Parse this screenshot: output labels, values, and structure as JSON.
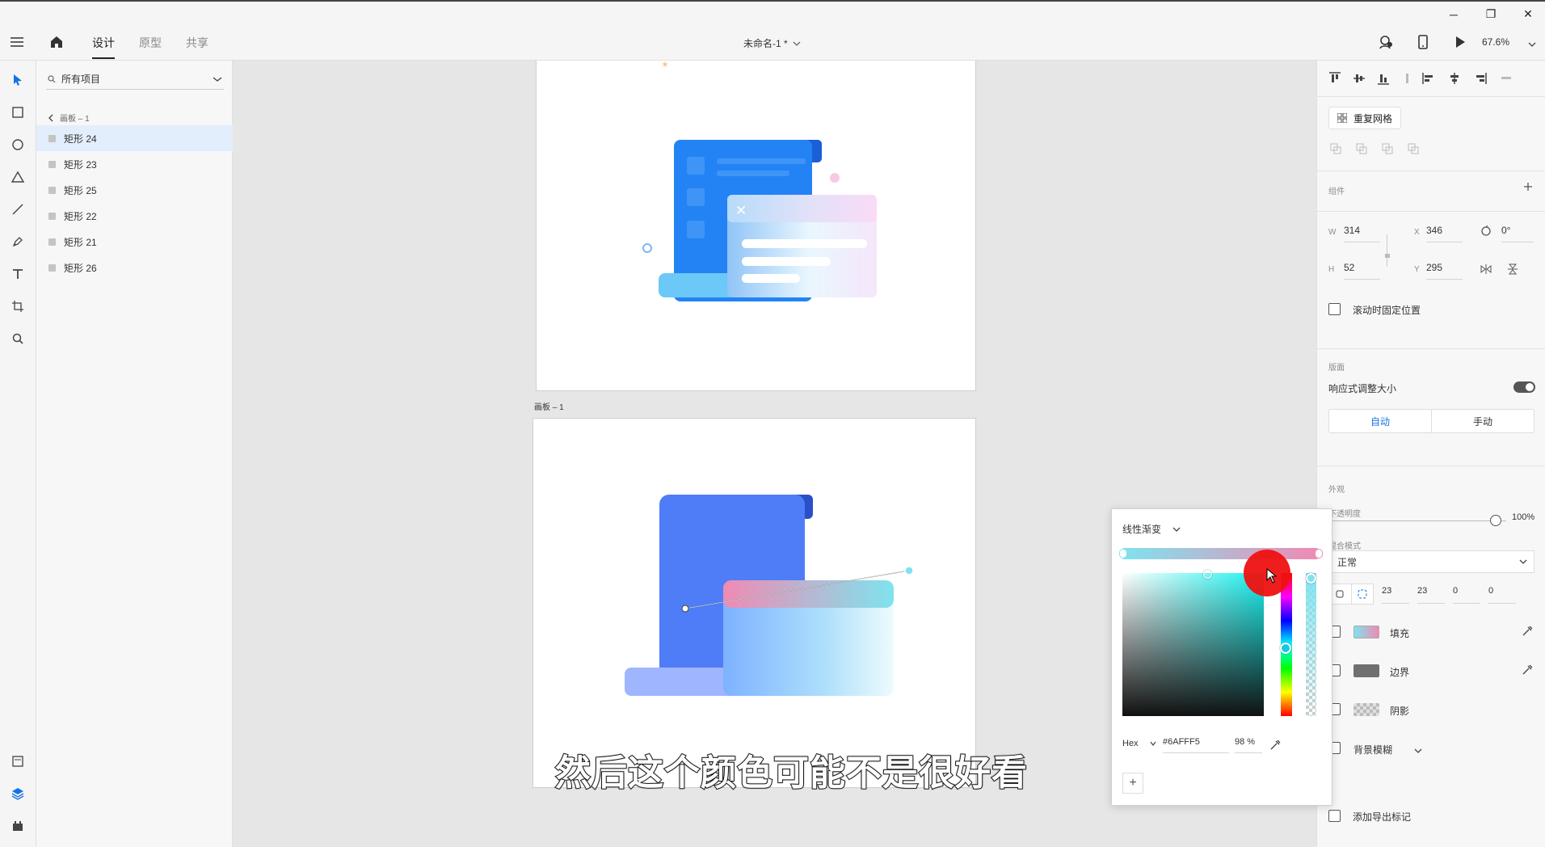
{
  "window": {
    "minimize_glyph": "─",
    "restore_glyph": "❐",
    "close_glyph": "✕"
  },
  "toolbar": {
    "tabs": [
      {
        "label": "设计"
      },
      {
        "label": "原型"
      },
      {
        "label": "共享"
      }
    ],
    "document_title": "未命名-1 *",
    "zoom": "67.6%"
  },
  "layers": {
    "filter_label": "所有项目",
    "breadcrumb": "画板 – 1",
    "items": [
      {
        "label": "矩形 24"
      },
      {
        "label": "矩形 23"
      },
      {
        "label": "矩形 25"
      },
      {
        "label": "矩形 22"
      },
      {
        "label": "矩形 21"
      },
      {
        "label": "矩形 26"
      }
    ]
  },
  "canvas": {
    "artboard_label": "画板 – 1",
    "close_glyph": "✕"
  },
  "props": {
    "repeat_grid_label": "重复网格",
    "component_label": "组件",
    "w_label": "W",
    "w_value": "314",
    "x_label": "X",
    "x_value": "346",
    "rotation_value": "0°",
    "h_label": "H",
    "h_value": "52",
    "y_label": "Y",
    "y_value": "295",
    "fix_scroll_label": "滚动时固定位置",
    "artboard_section": "版面",
    "responsive_label": "响应式调整大小",
    "auto_label": "自动",
    "manual_label": "手动",
    "appearance_label": "外观",
    "opacity_label": "不透明度",
    "opacity_value": "100%",
    "blend_label": "混合模式",
    "blend_value": "正常",
    "radius_values": [
      "23",
      "23",
      "0",
      "0"
    ],
    "fill_label": "填充",
    "border_label": "边界",
    "shadow_label": "阴影",
    "bg_blur_label": "背景模糊",
    "export_label": "添加导出标记"
  },
  "picker": {
    "mode_label": "线性渐变",
    "format_label": "Hex",
    "hex_value": "#6AFFF5",
    "alpha_value": "98 %",
    "add_glyph": "+"
  },
  "subtitle": "然后这个颜色可能不是很好看",
  "colors": {
    "accent": "#1473e6",
    "gradient_start": "#7fe3ee",
    "gradient_end": "#f08ab3",
    "cursor_highlight": "#ee1111"
  }
}
